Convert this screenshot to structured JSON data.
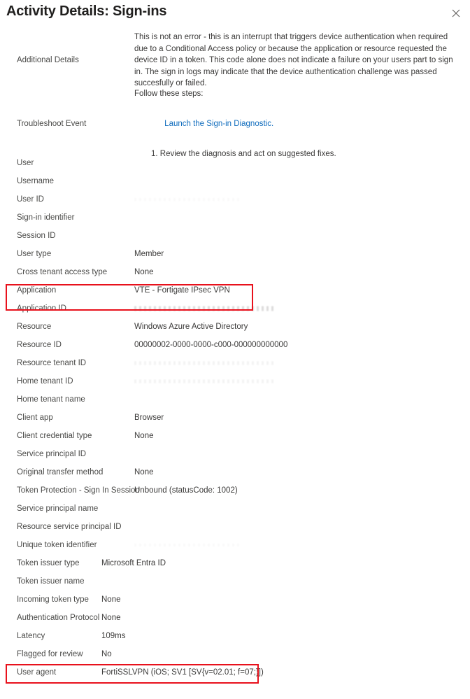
{
  "header": {
    "title": "Activity Details: Sign-ins",
    "close_icon": "close-icon",
    "close_label": "Close"
  },
  "additional_details": {
    "label": "Additional Details",
    "text": "This is not an error - this is an interrupt that triggers device authentication when required due to a Conditional Access policy or because the application or resource requested the device ID in a token. This code alone does not indicate a failure on your users part to sign in. The sign in logs may indicate that the device authentication challenge was passed succesfully or failed."
  },
  "troubleshoot": {
    "label": "Troubleshoot Event",
    "intro": "Follow these steps:",
    "link_text": "Launch the Sign-in Diagnostic.",
    "step_1": "1. Review the diagnosis and act on suggested fixes."
  },
  "rows_wide": [
    {
      "label": "User",
      "value": "",
      "state": "empty"
    },
    {
      "label": "Username",
      "value": "",
      "state": "empty"
    },
    {
      "label": "User ID",
      "value": "",
      "state": "ghost"
    },
    {
      "label": "Sign-in identifier",
      "value": "",
      "state": "empty"
    },
    {
      "label": "Session ID",
      "value": "",
      "state": "empty"
    },
    {
      "label": "User type",
      "value": "Member",
      "state": "text"
    },
    {
      "label": "Cross tenant access type",
      "value": "None",
      "state": "text"
    },
    {
      "label": "Application",
      "value": "VTE - Fortigate IPsec VPN",
      "state": "text"
    },
    {
      "label": "Application ID",
      "value": "",
      "state": "redacted"
    },
    {
      "label": "Resource",
      "value": "Windows Azure Active Directory",
      "state": "text"
    },
    {
      "label": "Resource ID",
      "value": "00000002-0000-0000-c000-000000000000",
      "state": "text"
    },
    {
      "label": "Resource tenant ID",
      "value": "",
      "state": "faint"
    },
    {
      "label": "Home tenant ID",
      "value": "",
      "state": "faint"
    },
    {
      "label": "Home tenant name",
      "value": "",
      "state": "empty"
    },
    {
      "label": "Client app",
      "value": "Browser",
      "state": "text"
    },
    {
      "label": "Client credential type",
      "value": "None",
      "state": "text"
    },
    {
      "label": "Service principal ID",
      "value": "",
      "state": "empty"
    },
    {
      "label": "Original transfer method",
      "value": "None",
      "state": "text"
    },
    {
      "label": "Token Protection - Sign In Session",
      "value": "Unbound (statusCode: 1002)",
      "state": "text"
    },
    {
      "label": "Service principal name",
      "value": "",
      "state": "empty"
    },
    {
      "label": "Resource service principal ID",
      "value": "",
      "state": "empty"
    },
    {
      "label": "Unique token identifier",
      "value": "",
      "state": "ghost"
    }
  ],
  "rows_narrow": [
    {
      "label": "Token issuer type",
      "value": "Microsoft Entra ID",
      "state": "text"
    },
    {
      "label": "Token issuer name",
      "value": "",
      "state": "empty"
    },
    {
      "label": "Incoming token type",
      "value": "None",
      "state": "text"
    },
    {
      "label": "Authentication Protocol",
      "value": "None",
      "state": "text"
    },
    {
      "label": "Latency",
      "value": "109ms",
      "state": "text"
    },
    {
      "label": "Flagged for review",
      "value": "No",
      "state": "text"
    },
    {
      "label": "User agent",
      "value": "FortiSSLVPN (iOS; SV1 [SV{v=02.01; f=07;}])",
      "state": "text"
    }
  ],
  "annotations": [
    {
      "name": "application-highlight",
      "color": "#e8111c",
      "targets": "Application"
    },
    {
      "name": "user-agent-highlight",
      "color": "#e8111c",
      "targets": "User agent"
    }
  ]
}
